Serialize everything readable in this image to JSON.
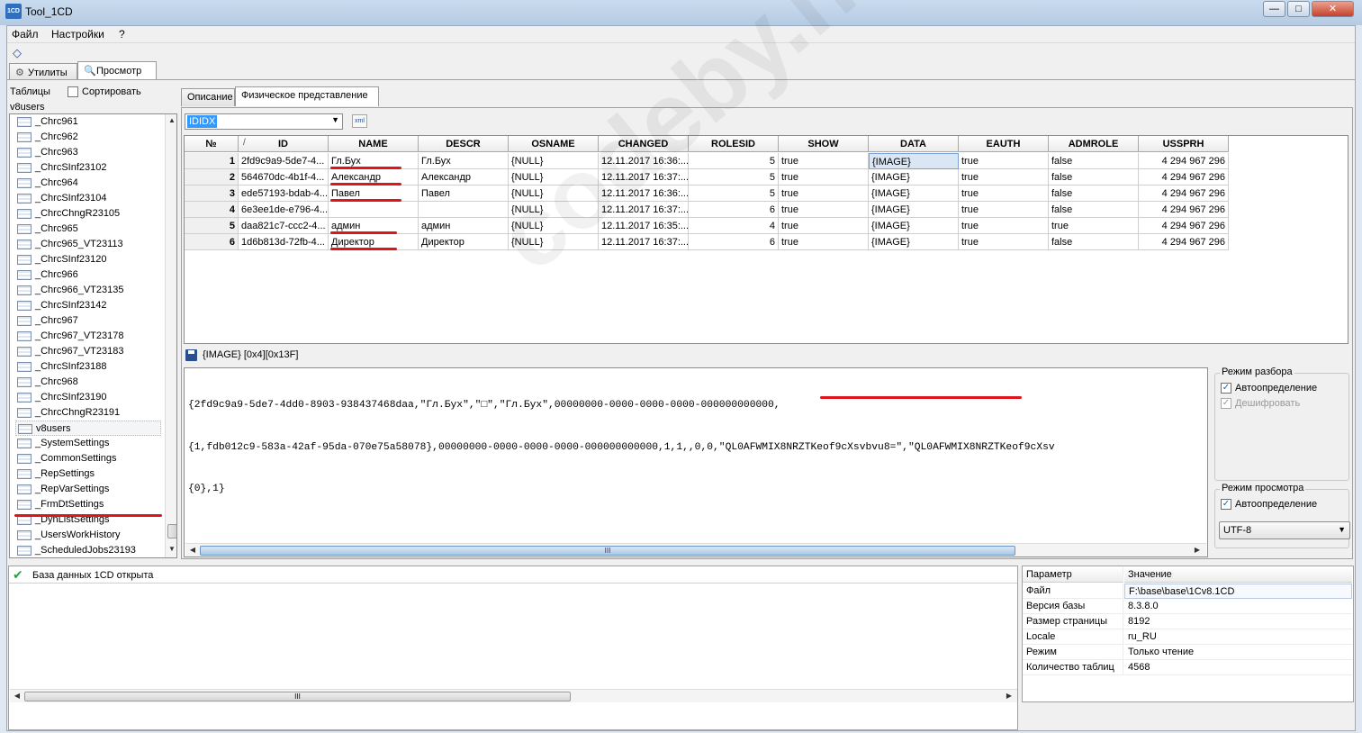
{
  "window": {
    "title": "Tool_1CD",
    "icon_text": "1CD",
    "min": "—",
    "max": "□",
    "close": "✕"
  },
  "menu": [
    "Файл",
    "Настройки",
    "?"
  ],
  "main_tabs": [
    {
      "label": "Утилиты",
      "active": false
    },
    {
      "label": "Просмотр",
      "active": true
    }
  ],
  "left": {
    "tables_label": "Таблицы",
    "sort_label": "Сортировать",
    "current_table": "v8users",
    "items": [
      "_Chrc961",
      "_Chrc962",
      "_Chrc963",
      "_ChrcSInf23102",
      "_Chrc964",
      "_ChrcSInf23104",
      "_ChrcChngR23105",
      "_Chrc965",
      "_Chrc965_VT23113",
      "_ChrcSInf23120",
      "_Chrc966",
      "_Chrc966_VT23135",
      "_ChrcSInf23142",
      "_Chrc967",
      "_Chrc967_VT23178",
      "_Chrc967_VT23183",
      "_ChrcSInf23188",
      "_Chrc968",
      "_ChrcSInf23190",
      "_ChrcChngR23191",
      "v8users",
      "_SystemSettings",
      "_CommonSettings",
      "_RepSettings",
      "_RepVarSettings",
      "_FrmDtSettings",
      "_DynListSettings",
      "_UsersWorkHistory",
      "_ScheduledJobs23193"
    ],
    "selected_index": 20
  },
  "sub_tabs": [
    {
      "label": "Описание",
      "active": false
    },
    {
      "label": "Физическое представление",
      "active": true
    }
  ],
  "index_combo": {
    "value": "IDIDX",
    "xml_icon": "xml"
  },
  "grid": {
    "columns": [
      "№",
      "ID",
      "NAME",
      "DESCR",
      "OSNAME",
      "CHANGED",
      "ROLESID",
      "SHOW",
      "DATA",
      "EAUTH",
      "ADMROLE",
      "USSPRH"
    ],
    "sort_marker": "/",
    "rows": [
      [
        "1",
        "2fd9c9a9-5de7-4...",
        "Гл.Бух",
        "Гл.Бух",
        "{NULL}",
        "12.11.2017 16:36:...",
        "5",
        "true",
        "{IMAGE}",
        "true",
        "false",
        "4 294 967 296"
      ],
      [
        "2",
        "564670dc-4b1f-4...",
        "Александр",
        "Александр",
        "{NULL}",
        "12.11.2017 16:37:...",
        "5",
        "true",
        "{IMAGE}",
        "true",
        "false",
        "4 294 967 296"
      ],
      [
        "3",
        "ede57193-bdab-4...",
        "Павел",
        "Павел",
        "{NULL}",
        "12.11.2017 16:36:...",
        "5",
        "true",
        "{IMAGE}",
        "true",
        "false",
        "4 294 967 296"
      ],
      [
        "4",
        "6e3ee1de-e796-4...",
        "",
        "",
        "{NULL}",
        "12.11.2017 16:37:...",
        "6",
        "true",
        "{IMAGE}",
        "true",
        "false",
        "4 294 967 296"
      ],
      [
        "5",
        "daa821c7-ccc2-4...",
        "админ",
        "админ",
        "{NULL}",
        "12.11.2017 16:35:...",
        "4",
        "true",
        "{IMAGE}",
        "true",
        "true",
        "4 294 967 296"
      ],
      [
        "6",
        "1d6b813d-72fb-4...",
        "Директор",
        "Директор",
        "{NULL}",
        "12.11.2017 16:37:...",
        "6",
        "true",
        "{IMAGE}",
        "true",
        "false",
        "4 294 967 296"
      ]
    ]
  },
  "blob": {
    "label": "{IMAGE} [0x4][0x13F]",
    "lines": [
      "{2fd9c9a9-5de7-4dd0-8903-938437468daa,\"Гл.Бух\",\"□\",\"Гл.Бух\",00000000-0000-0000-0000-000000000000,",
      "{1,fdb012c9-583a-42af-95da-070e75a58078},00000000-0000-0000-0000-000000000000,1,1,,0,0,\"QL0AFWMIX8NRZTKeof9cXsvbvu8=\",\"QL0AFWMIX8NRZTKeof9cXsv",
      "{0},1}"
    ],
    "scroll_grip": "III"
  },
  "parse_mode": {
    "title": "Режим разбора",
    "auto_label": "Автоопределение",
    "auto_checked": true,
    "decrypt_label": "Дешифровать",
    "decrypt_checked": true
  },
  "view_mode": {
    "title": "Режим просмотра",
    "auto_label": "Автоопределение",
    "auto_checked": true,
    "encoding": "UTF-8"
  },
  "log": {
    "message": "База данных 1CD открыта",
    "scroll_grip": "III"
  },
  "properties": {
    "headers": [
      "Параметр",
      "Значение"
    ],
    "rows": [
      [
        "Файл",
        "F:\\base\\base\\1Cv8.1CD"
      ],
      [
        "Версия базы",
        "8.3.8.0"
      ],
      [
        "Размер страницы",
        "8192"
      ],
      [
        "Locale",
        "ru_RU"
      ],
      [
        "Режим",
        "Только чтение"
      ],
      [
        "Количество таблиц",
        "4568"
      ]
    ]
  },
  "watermark": "codeby.net",
  "colors": {
    "accent": "#3399ff",
    "highlight_underline": "#e0141b",
    "check_ok": "#2ea043"
  }
}
